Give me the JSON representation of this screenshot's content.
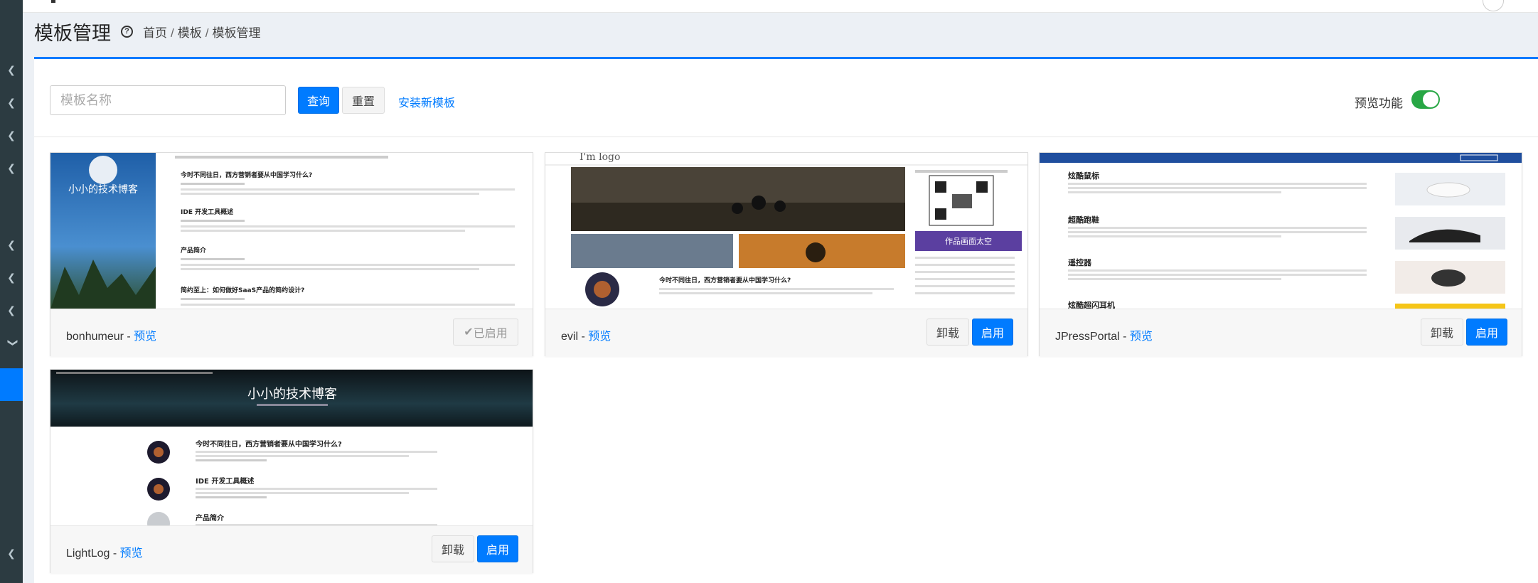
{
  "header": {
    "title": "模板管理",
    "breadcrumb": [
      "首页",
      "模板",
      "模板管理"
    ]
  },
  "toolbar": {
    "search_placeholder": "模板名称",
    "query_label": "查询",
    "reset_label": "重置",
    "install_label": "安装新模板",
    "preview_label": "预览功能",
    "preview_enabled": true
  },
  "colors": {
    "primary": "#007bff",
    "toggle_on": "#28a745",
    "sidebar": "#2c3b41"
  },
  "templates": [
    {
      "name": "bonhumeur",
      "preview_label": "预览",
      "status_label": "已启用",
      "enabled": true
    },
    {
      "name": "evil",
      "preview_label": "预览",
      "uninstall_label": "卸载",
      "enable_label": "启用",
      "enabled": false
    },
    {
      "name": "JPressPortal",
      "preview_label": "预览",
      "uninstall_label": "卸载",
      "enable_label": "启用",
      "enabled": false
    },
    {
      "name": "LightLog",
      "preview_label": "预览",
      "uninstall_label": "卸载",
      "enable_label": "启用",
      "enabled": false
    }
  ],
  "thumbnails": {
    "bonhumeur_blog_title": "小小的技术博客",
    "bonhumeur_posts": [
      "今时不同往日，西方营销者要从中国学习什么?",
      "IDE 开发工具概述",
      "产品简介",
      "简约至上：如何做好SaaS产品的简约设计?"
    ],
    "evil_logo": "I'm logo",
    "evil_post": "今时不同往日，西方营销者要从中国学习什么?",
    "evil_banner": "作品画面太空",
    "jpress_items": [
      "炫酷鼠标",
      "超酷跑鞋",
      "遥控器",
      "炫酷超闪耳机"
    ],
    "lightlog_title": "小小的技术博客",
    "lightlog_posts": [
      "今时不同往日，西方营销者要从中国学习什么?",
      "IDE 开发工具概述",
      "产品简介"
    ]
  }
}
